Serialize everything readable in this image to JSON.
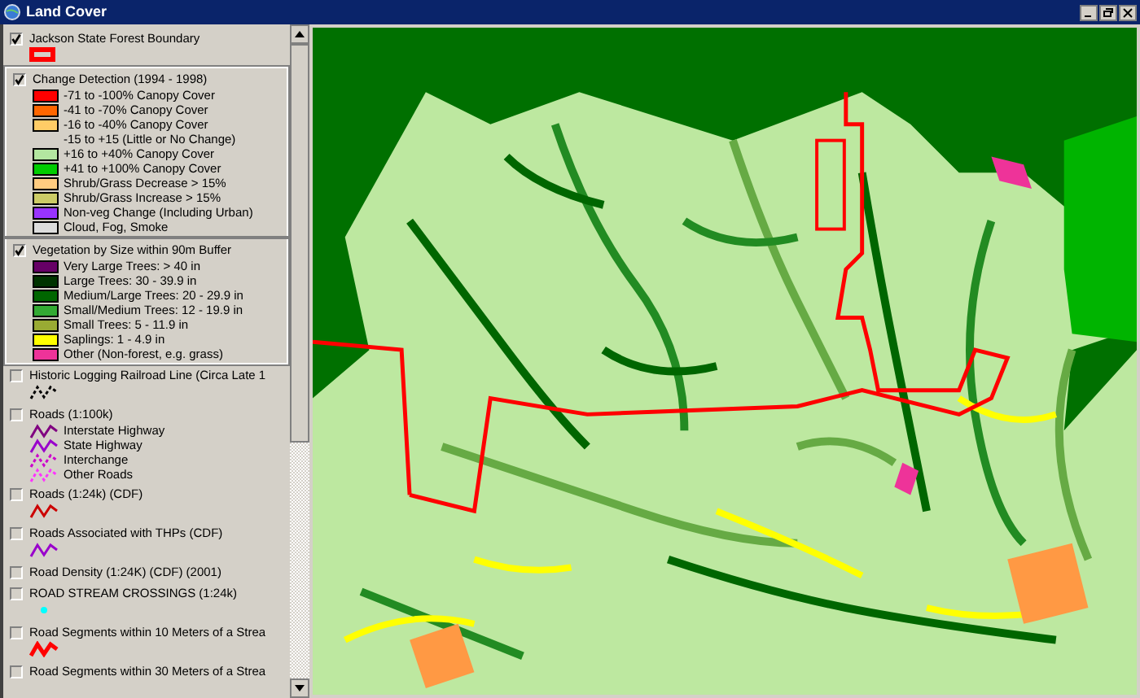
{
  "window": {
    "title": "Land Cover"
  },
  "legend": {
    "layers": [
      {
        "name": "Jackson State Forest Boundary",
        "checked": true,
        "selected": false,
        "classes": [
          {
            "kind": "box",
            "color": "#ff0000"
          }
        ]
      },
      {
        "name": "Change Detection (1994 - 1998)",
        "checked": true,
        "selected": true,
        "classes": [
          {
            "kind": "swatch",
            "color": "#ff0000",
            "label": "-71 to -100% Canopy Cover"
          },
          {
            "kind": "swatch",
            "color": "#ff6600",
            "label": "-41 to -70% Canopy Cover"
          },
          {
            "kind": "swatch",
            "color": "#ffcc66",
            "label": "-16 to -40% Canopy Cover"
          },
          {
            "kind": "none",
            "label": "-15 to +15 (Little or No Change)"
          },
          {
            "kind": "swatch",
            "color": "#b3e6a0",
            "label": "+16 to +40% Canopy Cover"
          },
          {
            "kind": "swatch",
            "color": "#00cc00",
            "label": "+41 to +100% Canopy Cover"
          },
          {
            "kind": "swatch",
            "color": "#ffcc80",
            "label": "Shrub/Grass Decrease > 15%"
          },
          {
            "kind": "swatch",
            "color": "#cccc66",
            "label": "Shrub/Grass Increase > 15%"
          },
          {
            "kind": "swatch",
            "color": "#9933ff",
            "label": "Non-veg Change (Including Urban)"
          },
          {
            "kind": "swatch",
            "color": "#dddddd",
            "label": "Cloud, Fog, Smoke"
          }
        ]
      },
      {
        "name": "Vegetation by Size within 90m Buffer",
        "checked": true,
        "selected": true,
        "classes": [
          {
            "kind": "swatch",
            "color": "#660066",
            "label": "Very Large Trees: > 40 in"
          },
          {
            "kind": "swatch",
            "color": "#003300",
            "label": "Large Trees: 30 - 39.9 in"
          },
          {
            "kind": "swatch",
            "color": "#006600",
            "label": "Medium/Large Trees: 20 - 29.9 in"
          },
          {
            "kind": "swatch",
            "color": "#33aa33",
            "label": "Small/Medium Trees: 12 - 19.9 in"
          },
          {
            "kind": "swatch",
            "color": "#99aa33",
            "label": "Small Trees: 5 - 11.9 in"
          },
          {
            "kind": "swatch",
            "color": "#ffff00",
            "label": "Saplings: 1 - 4.9 in"
          },
          {
            "kind": "swatch",
            "color": "#ee3399",
            "label": "Other (Non-forest, e.g. grass)"
          }
        ]
      },
      {
        "name": "Historic Logging Railroad Line (Circa Late 1",
        "checked": false,
        "selected": false,
        "classes": [
          {
            "kind": "dashed",
            "color": "#000000"
          }
        ]
      },
      {
        "name": "Roads (1:100k)",
        "checked": false,
        "selected": false,
        "classes": [
          {
            "kind": "line",
            "color": "#800080",
            "label": "Interstate Highway"
          },
          {
            "kind": "line",
            "color": "#9900cc",
            "label": "State Highway"
          },
          {
            "kind": "dashed",
            "color": "#cc00cc",
            "label": "Interchange"
          },
          {
            "kind": "dashed",
            "color": "#ff33ff",
            "label": "Other Roads"
          }
        ]
      },
      {
        "name": "Roads (1:24k) (CDF)",
        "checked": false,
        "selected": false,
        "classes": [
          {
            "kind": "line",
            "color": "#cc0000"
          }
        ]
      },
      {
        "name": "Roads Associated with THPs (CDF)",
        "checked": false,
        "selected": false,
        "classes": [
          {
            "kind": "line",
            "color": "#9900cc"
          }
        ]
      },
      {
        "name": "Road Density (1:24K) (CDF) (2001)",
        "checked": false,
        "selected": false
      },
      {
        "name": "ROAD STREAM CROSSINGS (1:24k)",
        "checked": false,
        "selected": false,
        "classes": [
          {
            "kind": "dot",
            "color": "#00ffff"
          }
        ]
      },
      {
        "name": "Road Segments within 10 Meters of a Strea",
        "checked": false,
        "selected": false,
        "classes": [
          {
            "kind": "thick",
            "color": "#ff0000"
          }
        ]
      },
      {
        "name": "Road Segments within 30 Meters of a Strea",
        "checked": false,
        "selected": false
      }
    ]
  }
}
